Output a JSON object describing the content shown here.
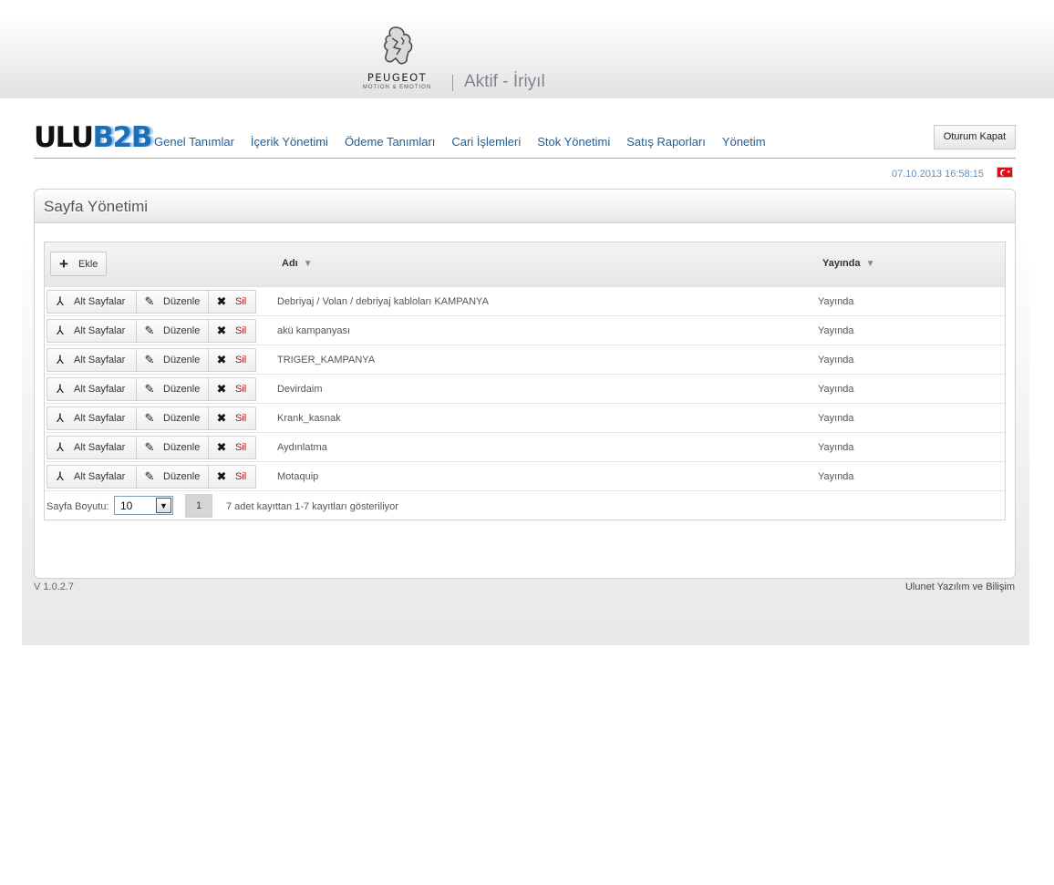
{
  "header": {
    "brand_name": "PEUGEOT",
    "brand_slogan": "MOTION & EMOTION",
    "dealer_name": "Aktif - İriyıl"
  },
  "logo": {
    "part1": "ULU",
    "part2": "B2B"
  },
  "nav": {
    "items": [
      "Genel Tanımlar",
      "İçerik Yönetimi",
      "Ödeme Tanımları",
      "Cari İşlemleri",
      "Stok Yönetimi",
      "Satış Raporları",
      "Yönetim"
    ],
    "logout_label": "Oturum Kapat",
    "datetime": "07.10.2013 16:58:15"
  },
  "panel": {
    "title": "Sayfa Yönetimi"
  },
  "grid": {
    "add_label": "Ekle",
    "columns": {
      "name": "Adı",
      "published": "Yayında"
    },
    "actions": {
      "sub_pages": "Alt Sayfalar",
      "edit": "Düzenle",
      "delete": "Sil"
    },
    "rows": [
      {
        "name": "Debriyaj / Volan / debriyaj kabloları KAMPANYA",
        "published": "Yayında"
      },
      {
        "name": "akü kampanyası",
        "published": "Yayında"
      },
      {
        "name": "TRIGER_KAMPANYA",
        "published": "Yayında"
      },
      {
        "name": "Devirdaim",
        "published": "Yayında"
      },
      {
        "name": "Krank_kasnak",
        "published": "Yayında"
      },
      {
        "name": "Aydınlatma",
        "published": "Yayında"
      },
      {
        "name": "Motaquip",
        "published": "Yayında"
      }
    ],
    "pager": {
      "page_size_label": "Sayfa Boyutu:",
      "page_size": "10",
      "current_page": "1",
      "info": "7 adet kayıttan 1-7 kayıtları gösteriliyor"
    }
  },
  "footer": {
    "version": "V 1.0.2.7",
    "company": "Ulunet Yazılım ve Bilişim"
  },
  "colors": {
    "nav_link": "#1f5d96",
    "accent_blue": "#1d6fb8",
    "delete_red": "#a31515",
    "flag_red": "#e30a17"
  }
}
